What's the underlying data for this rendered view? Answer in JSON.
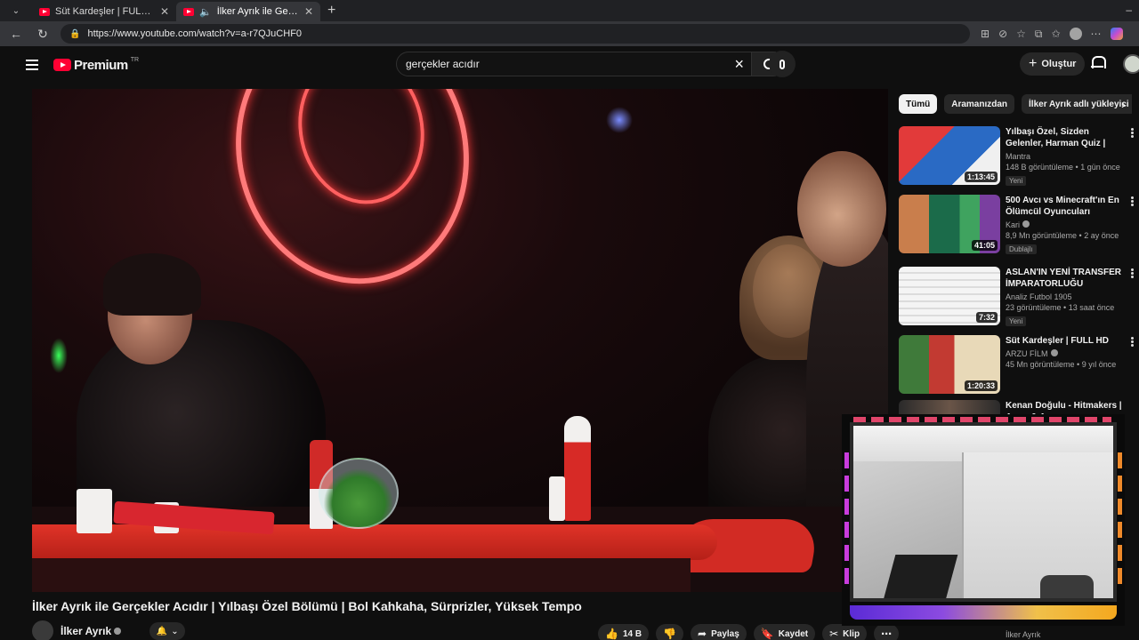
{
  "browser": {
    "tabs": [
      {
        "title": "Süt Kardeşler | FULL HD - YouTube",
        "active": false,
        "playing": false
      },
      {
        "title": "İlker Ayrık ile Gerçekler Acıdır",
        "active": true,
        "playing": true
      }
    ],
    "url": "https://www.youtube.com/watch?v=a-r7QJuCHF0",
    "window_min": "–"
  },
  "youtube": {
    "logo_text": "Premium",
    "logo_country": "TR",
    "search_value": "gerçekler acıdır",
    "create_label": "Oluştur",
    "accent": "#ff0033"
  },
  "video": {
    "title": "İlker Ayrık ile Gerçekler Acıdır | Yılbaşı Özel Bölümü | Bol Kahkaha, Sürprizler, Yüksek Tempo",
    "channel": "İlker Ayrık",
    "likes": "14 B",
    "share_label": "Paylaş",
    "save_label": "Kaydet",
    "clip_label": "Klip"
  },
  "chips": [
    "Tümü",
    "Aramanızdan",
    "İlker Ayrık adlı yükleyici"
  ],
  "recommendations": [
    {
      "title": "Yılbaşı Özel, Sizden Gelenler, Harman Quiz | Erman Yaşar & ...",
      "channel": "Mantra",
      "meta": "148 B görüntüleme • 1 gün önce",
      "badge": "Yeni",
      "duration": "1:13:45",
      "verified": false
    },
    {
      "title": "500 Avcı vs Minecraft'ın En Ölümcül Oyuncuları",
      "channel": "Kari",
      "meta": "8,9 Mn görüntüleme • 2 ay önce",
      "badge": "Dublajlı",
      "duration": "41:05",
      "verified": true
    },
    {
      "title": "ASLAN'IN YENİ TRANSFER İMPARATORLUĞU YILDIZLARI",
      "channel": "Analiz Futbol 1905",
      "meta": "23 görüntüleme • 13 saat önce",
      "badge": "Yeni",
      "duration": "7:32",
      "verified": false
    },
    {
      "title": "Süt Kardeşler | FULL HD",
      "channel": "ARZU FİLM",
      "meta": "45 Mn görüntüleme • 9 yıl önce",
      "badge": "",
      "duration": "1:20:33",
      "verified": true
    },
    {
      "title": "Kenan Doğulu - Hitmakers | Arem & Arman",
      "channel": "",
      "meta": "",
      "badge": "",
      "duration": "",
      "verified": false
    }
  ],
  "bottom_peek_channel": "İlker Ayrık"
}
